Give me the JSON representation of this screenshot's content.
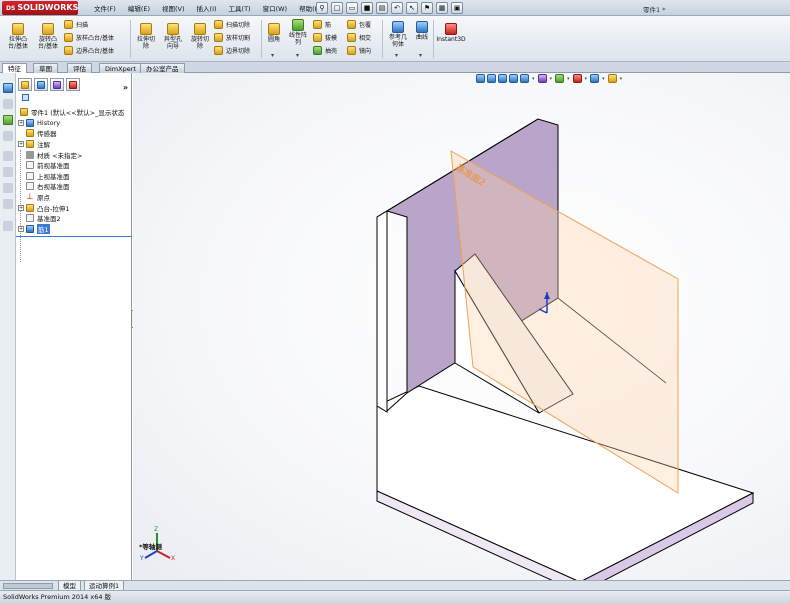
{
  "app": {
    "logo_prefix": "DS",
    "logo_text": "SOLIDWORKS",
    "doc_title": "零件1 *",
    "brand_color": "#c8211a"
  },
  "menu": [
    "文件(F)",
    "编辑(E)",
    "视图(V)",
    "插入(I)",
    "工具(T)",
    "窗口(W)",
    "帮助(H)"
  ],
  "ribbon": {
    "extrude_boss": [
      "拉伸凸",
      "台/基体"
    ],
    "revolve_boss": [
      "旋转凸",
      "台/基体"
    ],
    "sweep": "扫描",
    "loft": "放样凸台/基体",
    "boundary": "边界凸台/基体",
    "extrude_cut": [
      "拉伸切",
      "除"
    ],
    "hole_wizard": [
      "异型孔",
      "向导"
    ],
    "revolve_cut": [
      "旋转切",
      "除"
    ],
    "sweep_cut": "扫描切除",
    "loft_cut": "放样切割",
    "boundary_cut": "边界切除",
    "fillet": "圆角",
    "linear_pattern": [
      "线性阵",
      "列"
    ],
    "rib": "筋",
    "draft": "拔模",
    "shell": "抽壳",
    "wrap": "包覆",
    "intersect": "相交",
    "mirror": "镜向",
    "ref_geometry": [
      "参考几",
      "何体"
    ],
    "curves": "曲线",
    "instant3d": "Instant3D"
  },
  "tabs": [
    "特征",
    "草图",
    "评估",
    "DimXpert",
    "办公室产品"
  ],
  "tree": {
    "root": "零件1 (默认<<默认>_显示状态",
    "items": [
      "History",
      "传感器",
      "注解",
      "材质 <未指定>",
      "前视基准面",
      "上视基准面",
      "右视基准面",
      "原点",
      "凸台-拉伸1",
      "基准面2",
      "筋1"
    ]
  },
  "graphics": {
    "view_label": "*等轴测",
    "plane_label": "基准面2",
    "triad_z": "Z",
    "triad_x": "X",
    "triad_y": "Y"
  },
  "bottom_tabs": [
    "模型",
    "运动算例1"
  ],
  "status": "SolidWorks Premium 2014 x64 版"
}
